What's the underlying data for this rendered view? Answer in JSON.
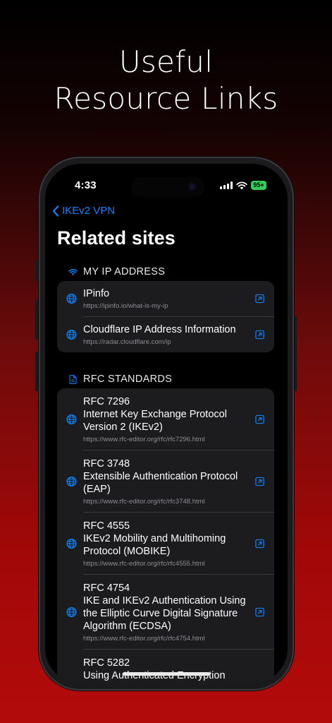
{
  "promo": {
    "line1": "Useful",
    "line2": "Resource Links"
  },
  "status_bar": {
    "time": "4:33",
    "battery": "95+"
  },
  "nav": {
    "back_label": "IKEv2 VPN"
  },
  "page": {
    "title": "Related sites"
  },
  "sections": {
    "my_ip": {
      "header": "MY IP ADDRESS",
      "items": [
        {
          "title": "IPinfo",
          "url": "https://ipinfo.io/what-is-my-ip"
        },
        {
          "title": "Cloudflare IP Address Information",
          "url": "https://radar.cloudflare.com/ip"
        }
      ]
    },
    "rfc": {
      "header": "RFC STANDARDS",
      "items": [
        {
          "number": "RFC 7296",
          "name": "Internet Key Exchange Protocol Version 2 (IKEv2)",
          "url": "https://www.rfc-editor.org/rfc/rfc7296.html"
        },
        {
          "number": "RFC 3748",
          "name": "Extensible Authentication Protocol (EAP)",
          "url": "https://www.rfc-editor.org/rfc/rfc3748.html"
        },
        {
          "number": "RFC 4555",
          "name": "IKEv2 Mobility and Multihoming Protocol (MOBIKE)",
          "url": "https://www.rfc-editor.org/rfc/rfc4555.html"
        },
        {
          "number": "RFC 4754",
          "name": "IKE and IKEv2 Authentication Using the Elliptic Curve Digital Signature Algorithm (ECDSA)",
          "url": "https://www.rfc-editor.org/rfc/rfc4754.html"
        },
        {
          "number": "RFC 5282",
          "name": "Using Authenticated Encryption"
        }
      ]
    }
  },
  "icons": {
    "back": "chevron-left-icon",
    "my_ip_header": "wifi-icon",
    "rfc_header": "document-icon",
    "row_leading": "globe-icon",
    "row_trailing": "external-link-icon"
  },
  "colors": {
    "accent": "#0a84ff",
    "battery": "#30d158",
    "card": "#1c1c1e",
    "secondary_text": "#8e8e93"
  }
}
